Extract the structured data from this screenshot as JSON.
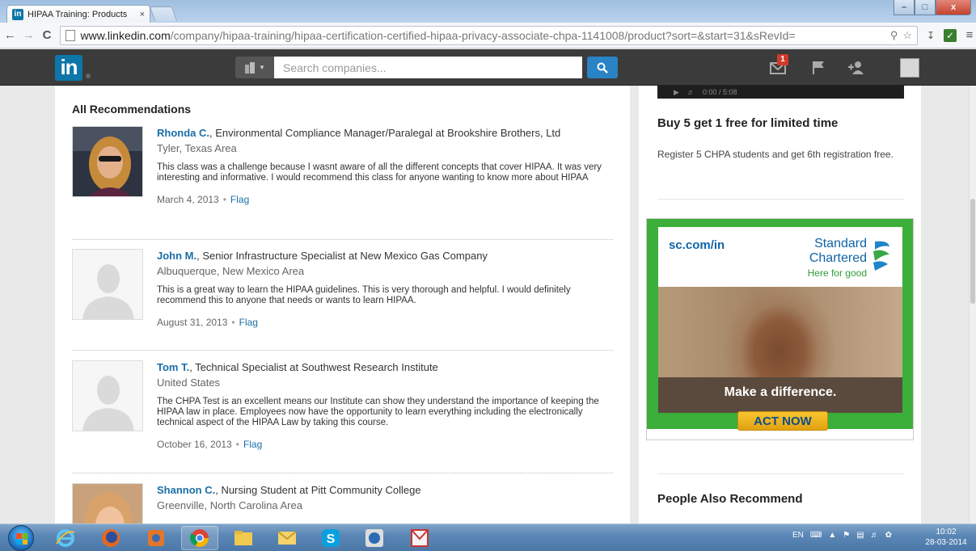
{
  "browser": {
    "tab_title": "HIPAA Training: Products",
    "tab_close": "×",
    "url_host": "www.linkedin.com",
    "url_path": "/company/hipaa-training/hipaa-certification-certified-hipaa-privacy-associate-chpa-1141008/product?sort=&start=31&sRevId=",
    "window_min": "–",
    "window_max": "□",
    "window_close": "x"
  },
  "header": {
    "logo_text": "in",
    "search_placeholder": "Search companies...",
    "messages_badge": "1"
  },
  "section_title": "All Recommendations",
  "recommendations": [
    {
      "name": "Rhonda C.",
      "headline": ", Environmental Compliance Manager/Paralegal at Brookshire Brothers, Ltd",
      "location": "Tyler, Texas Area",
      "text": "This class was a challenge because I wasnt aware of all the different concepts that cover HIPAA. It was very interesting and informative. I would recommend this class for anyone wanting to know more about HIPAA",
      "date": "March 4, 2013",
      "flag": "Flag"
    },
    {
      "name": "John M.",
      "headline": ", Senior Infrastructure Specialist at New Mexico Gas Company",
      "location": "Albuquerque, New Mexico Area",
      "text": "This is a great way to learn the HIPAA guidelines. This is very thorough and helpful. I would definitely recommend this to anyone that needs or wants to learn HIPAA.",
      "date": "August 31, 2013",
      "flag": "Flag"
    },
    {
      "name": "Tom T.",
      "headline": ", Technical Specialist at Southwest Research Institute",
      "location": "United States",
      "text": "The CHPA Test is an excellent means our Institute can show they understand the importance of keeping the HIPAA law in place. Employees now have the opportunity to learn everything including the electronically technical aspect of the HIPAA Law by taking this course.",
      "date": "October 16, 2013",
      "flag": "Flag"
    },
    {
      "name": "Shannon C.",
      "headline": ", Nursing Student at Pitt Community College",
      "location": "Greenville, North Carolina Area"
    }
  ],
  "separator": "•",
  "sidebar": {
    "video_time": "0:00 / 5:08",
    "promo_title": "Buy 5 get 1 free for limited time",
    "promo_text": "Register 5 CHPA students and get 6th registration free.",
    "ad": {
      "url": "sc.com/in",
      "brand_line1": "Standard",
      "brand_line2": "Chartered",
      "tagline": "Here for good",
      "headline": "Make a difference.",
      "cta": "ACT NOW"
    },
    "people_title": "People Also Recommend"
  },
  "taskbar": {
    "tray_lang": "EN",
    "clock_time": "10:02",
    "clock_date": "28-03-2014"
  },
  "colors": {
    "linkedin_blue": "#0e76a8",
    "link": "#1a6ea8",
    "header_bg": "#3b3b3b",
    "ad_green": "#3cae3a"
  }
}
